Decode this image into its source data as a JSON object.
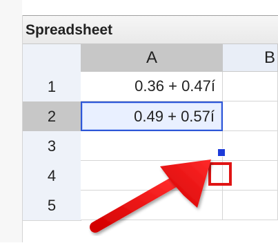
{
  "panel": {
    "title": "Spreadsheet"
  },
  "columns": [
    "A",
    "B"
  ],
  "rows": [
    {
      "label": "1",
      "A": "0.36 + 0.47í",
      "B": ""
    },
    {
      "label": "2",
      "A": "0.49 + 0.57í",
      "B": ""
    },
    {
      "label": "3",
      "A": "",
      "B": ""
    },
    {
      "label": "4",
      "A": "",
      "B": ""
    },
    {
      "label": "5",
      "A": "",
      "B": ""
    }
  ],
  "selection": {
    "cell": "A2"
  },
  "colors": {
    "selection_border": "#2d56d6",
    "fill_handle": "#1d3bd9",
    "highlight_outline": "#e01414",
    "arrow": "#e01414"
  }
}
